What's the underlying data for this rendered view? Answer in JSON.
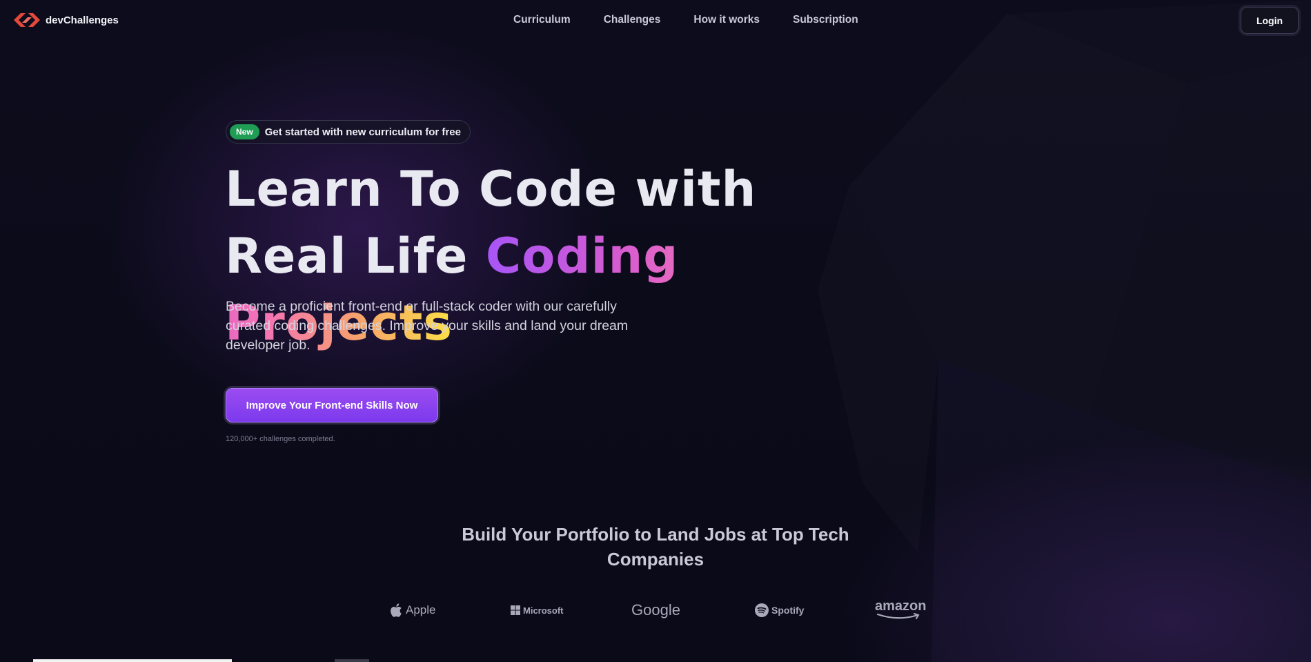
{
  "brand": {
    "name": "devChallenges",
    "logo_icon": "devchallenges-logo-icon",
    "accent": "#e5483b"
  },
  "nav": {
    "items": [
      {
        "label": "Curriculum"
      },
      {
        "label": "Challenges"
      },
      {
        "label": "How it works"
      },
      {
        "label": "Subscription"
      }
    ],
    "login_label": "Login"
  },
  "hero": {
    "badge": "New",
    "badge_color": "#1f9d55",
    "announcement": "Get started with new curriculum for free",
    "title_plain": "Learn To Code with Real Life ",
    "title_gradient": "Coding Projects",
    "subtitle": "Become a proficient front-end or full-stack coder with our carefully curated coding challenges. Improve your skills and land your dream developer job.",
    "cta_label": "Improve Your Front-end Skills Now",
    "cta_color": "#7c3aed",
    "cta_note": "120,000+ challenges completed."
  },
  "companies": {
    "title": "Build Your Portfolio to Land Jobs at Top Tech Companies",
    "logos": [
      {
        "name": "Apple",
        "icon": "apple-icon"
      },
      {
        "name": "Microsoft",
        "icon": "microsoft-icon"
      },
      {
        "name": "Google",
        "icon": "google-wordmark"
      },
      {
        "name": "Spotify",
        "icon": "spotify-icon"
      },
      {
        "name": "amazon",
        "icon": "amazon-smile-icon"
      }
    ]
  }
}
